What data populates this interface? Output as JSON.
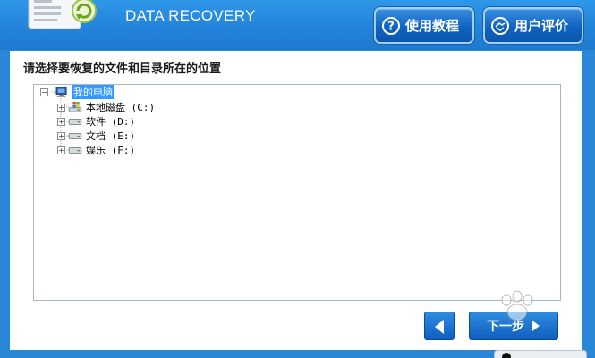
{
  "header": {
    "title": "DATA RECOVERY",
    "help_button": "使用教程",
    "review_button": "用户评价"
  },
  "main": {
    "prompt": "请选择要恢复的文件和目录所在的位置",
    "tree": {
      "root": "我的电脑",
      "drives": [
        {
          "label": "本地磁盘 (C:)",
          "icon": "windows-drive-icon"
        },
        {
          "label": "软件 (D:)",
          "icon": "drive-icon"
        },
        {
          "label": "文档 (E:)",
          "icon": "drive-icon"
        },
        {
          "label": "娱乐 (F:)",
          "icon": "drive-icon"
        }
      ]
    }
  },
  "nav": {
    "next_label": "下一步"
  },
  "colors": {
    "header_blue": "#2282d9",
    "button_blue": "#1063c2",
    "selection": "#3399ff"
  }
}
